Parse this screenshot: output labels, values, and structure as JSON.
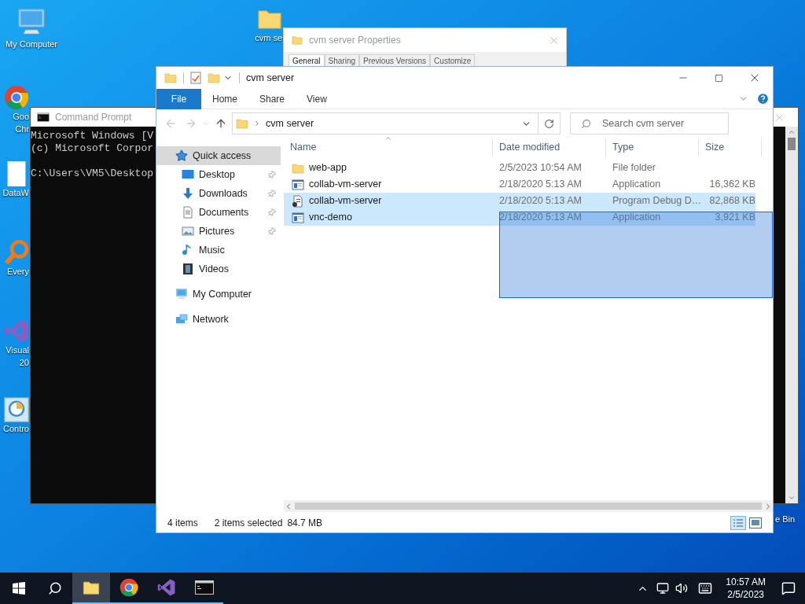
{
  "desktop_icons": [
    {
      "kind": "computer",
      "lines": [
        "My Computer"
      ]
    },
    {
      "kind": "folder",
      "lines": [
        "cvm se"
      ]
    },
    {
      "kind": "chrome",
      "lines": [
        "Goo",
        "Chr"
      ]
    },
    {
      "kind": "file",
      "lines": [
        "DataW"
      ]
    },
    {
      "kind": "search-app",
      "lines": [
        "Every"
      ]
    },
    {
      "kind": "studio",
      "lines": [
        "Visual",
        "20"
      ]
    },
    {
      "kind": "control",
      "lines": [
        "Contro"
      ]
    },
    {
      "kind": "bin",
      "lines": [
        "e Bin"
      ]
    }
  ],
  "properties_window": {
    "title": "cvm server Properties",
    "tabs": [
      {
        "label": "General",
        "selected": true
      },
      {
        "label": "Sharing",
        "selected": false
      },
      {
        "label": "Previous Versions",
        "selected": false
      },
      {
        "label": "Customize",
        "selected": false
      }
    ]
  },
  "command_prompt": {
    "title": "Command Prompt",
    "lines": [
      "Microsoft Windows [V",
      "(c) Microsoft Corpor"
    ],
    "prompt": "C:\\Users\\VM5\\Desktop"
  },
  "explorer": {
    "title": "cvm server",
    "ribbon_tabs": [
      {
        "label": "File",
        "kind": "menu"
      },
      {
        "label": "Home",
        "kind": "tab"
      },
      {
        "label": "Share",
        "kind": "tab"
      },
      {
        "label": "View",
        "kind": "tab"
      }
    ],
    "address": {
      "path": [
        "cvm server"
      ]
    },
    "search": {
      "placeholder": "Search cvm server"
    },
    "nav": [
      {
        "label": "Quick access",
        "kind": "star",
        "selected": true,
        "pinned": false,
        "children": [
          {
            "label": "Desktop",
            "kind": "desktop",
            "selected": false,
            "pinned": true
          },
          {
            "label": "Downloads",
            "kind": "downloads",
            "selected": false,
            "pinned": true
          },
          {
            "label": "Documents",
            "kind": "documents",
            "selected": false,
            "pinned": true
          },
          {
            "label": "Pictures",
            "kind": "pictures",
            "selected": false,
            "pinned": true
          },
          {
            "label": "Music",
            "kind": "music",
            "selected": false,
            "pinned": false
          },
          {
            "label": "Videos",
            "kind": "videos",
            "selected": false,
            "pinned": false
          }
        ]
      },
      {
        "label": "My Computer",
        "kind": "computer",
        "selected": false,
        "pinned": false
      },
      {
        "label": "Network",
        "kind": "network",
        "selected": false,
        "pinned": false
      }
    ],
    "columns": [
      {
        "label": "Name",
        "sorted": true
      },
      {
        "label": "Date modified",
        "sorted": false
      },
      {
        "label": "Type",
        "sorted": false
      },
      {
        "label": "Size",
        "sorted": false
      }
    ],
    "files": [
      {
        "name": "web-app",
        "date": "2/5/2023 10:54 AM",
        "type": "File folder",
        "kind": "folder",
        "selected": false
      },
      {
        "name": "collab-vm-server",
        "date": "2/18/2020 5:13 AM",
        "type": "Application",
        "size": "16,362 KB",
        "kind": "app",
        "selected": false
      },
      {
        "name": "collab-vm-server",
        "date": "2/18/2020 5:13 AM",
        "type": "Program Debug D…",
        "size": "82,868 KB",
        "kind": "debug",
        "selected": true
      },
      {
        "name": "vnc-demo",
        "date": "2/18/2020 5:13 AM",
        "type": "Application",
        "size": "3,921 KB",
        "kind": "app",
        "selected": true
      }
    ],
    "status_bar": {
      "item_count": "4 items",
      "selection": "2 items selected",
      "selection_size": "84.7 MB"
    }
  },
  "taskbar": {
    "apps": [
      {
        "kind": "explorer",
        "active": true
      },
      {
        "kind": "chrome",
        "active": false
      },
      {
        "kind": "studio",
        "active": false
      },
      {
        "kind": "terminal",
        "active": false
      }
    ],
    "time": "10:57 AM",
    "date": "2/5/2023"
  }
}
